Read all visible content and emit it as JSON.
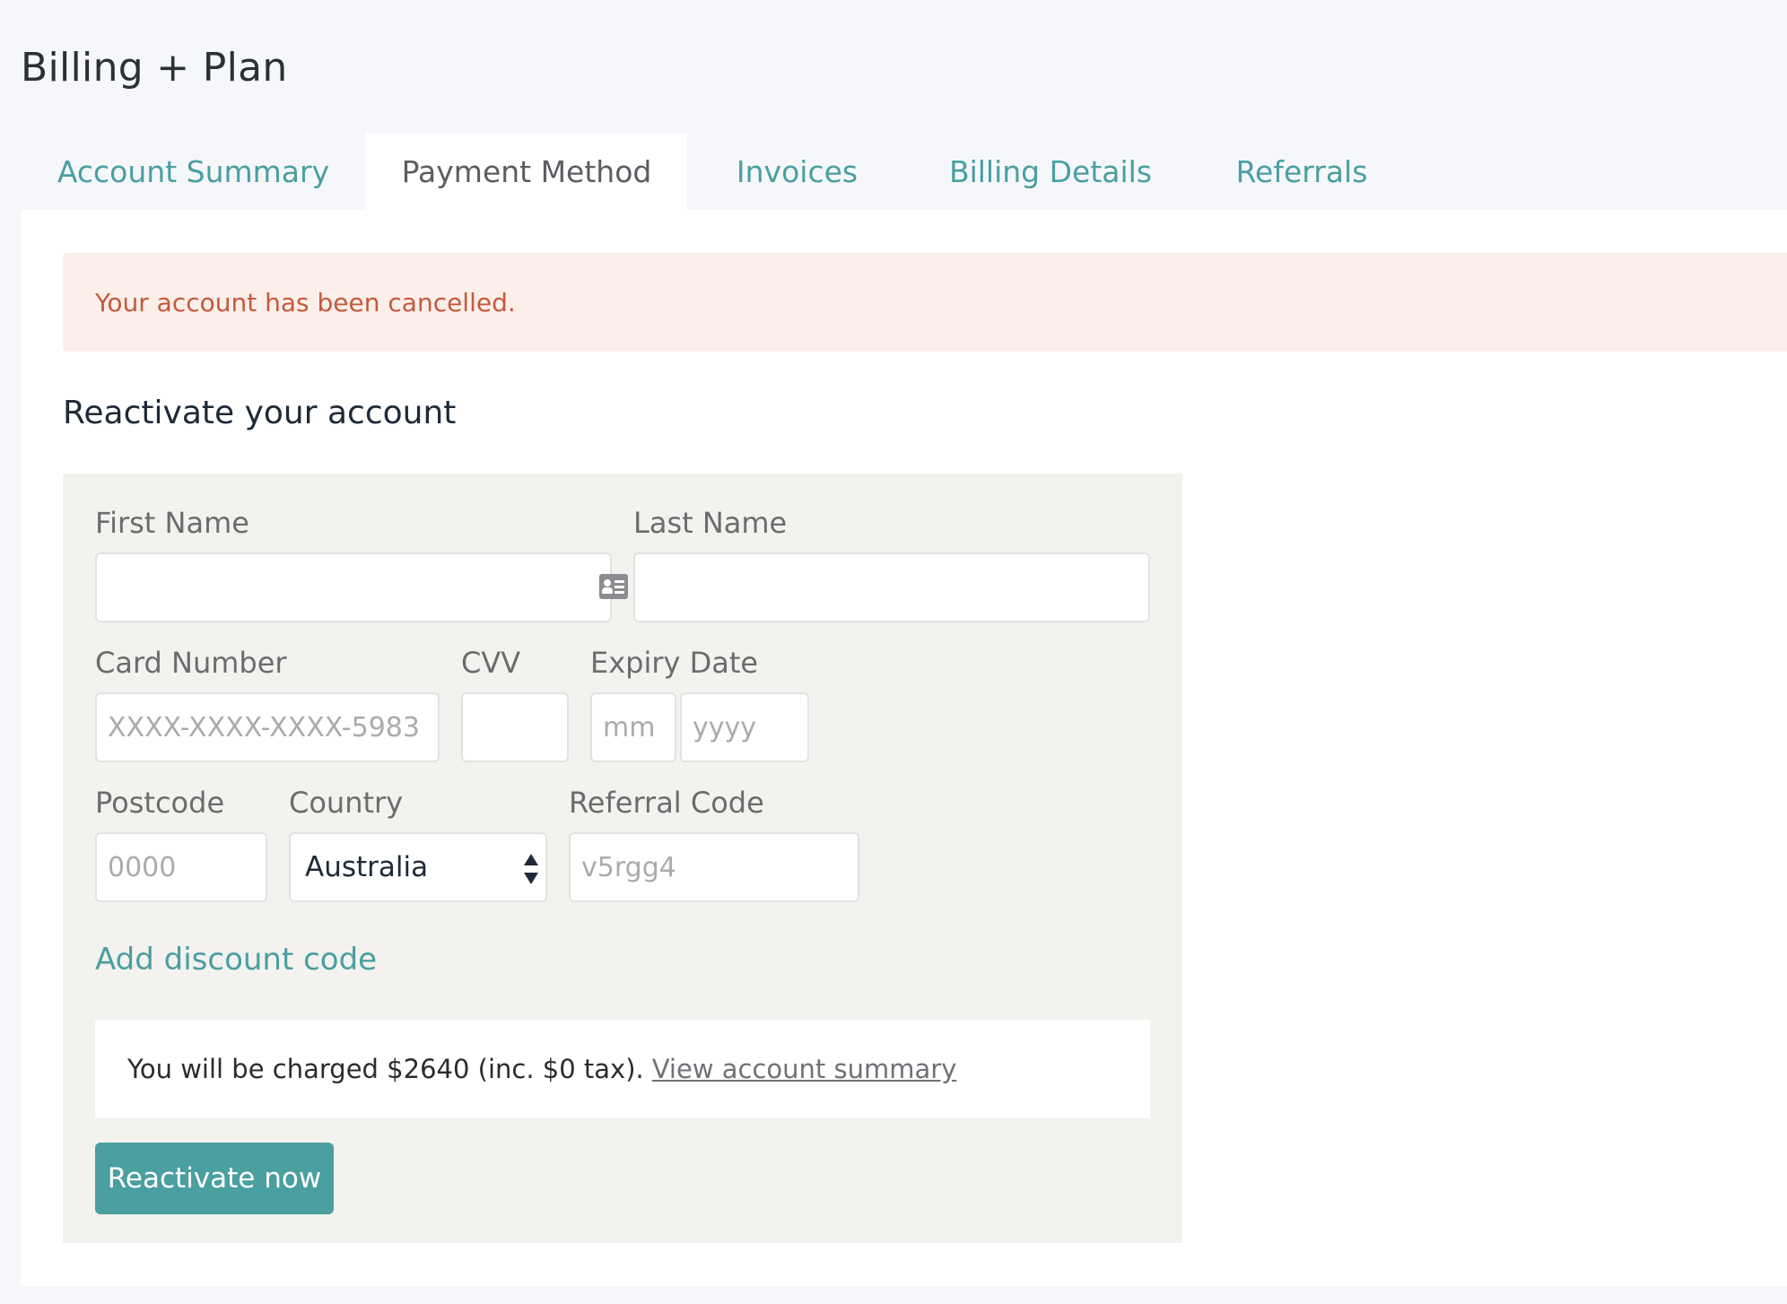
{
  "header": {
    "title": "Billing + Plan"
  },
  "tabs": [
    {
      "label": "Account Summary",
      "active": false
    },
    {
      "label": "Payment Method",
      "active": true
    },
    {
      "label": "Invoices",
      "active": false
    },
    {
      "label": "Billing Details",
      "active": false
    },
    {
      "label": "Referrals",
      "active": false
    }
  ],
  "alert": {
    "message": "Your account has been cancelled."
  },
  "section": {
    "title": "Reactivate your account"
  },
  "form": {
    "first_name": {
      "label": "First Name",
      "value": "",
      "placeholder": ""
    },
    "last_name": {
      "label": "Last Name",
      "value": "",
      "placeholder": ""
    },
    "card_number": {
      "label": "Card Number",
      "value": "",
      "placeholder": "XXXX-XXXX-XXXX-5983"
    },
    "cvv": {
      "label": "CVV",
      "value": "",
      "placeholder": ""
    },
    "expiry": {
      "label": "Expiry Date",
      "month_placeholder": "mm",
      "year_placeholder": "yyyy"
    },
    "postcode": {
      "label": "Postcode",
      "value": "",
      "placeholder": "0000"
    },
    "country": {
      "label": "Country",
      "selected": "Australia"
    },
    "referral_code": {
      "label": "Referral Code",
      "value": "",
      "placeholder": "v5rgg4"
    },
    "discount_link": "Add discount code",
    "charge_text": "You will be charged $2640 (inc. $0 tax).",
    "charge_link": "View account summary",
    "submit_label": "Reactivate now"
  },
  "colors": {
    "accent": "#4a9fa0",
    "alert_bg": "#fcefea",
    "alert_text": "#c45a3c",
    "form_bg": "#f3f2ee",
    "page_bg": "#f6f7fb"
  },
  "icons": {
    "first_name_field": "contact-card-icon",
    "country_select": "select-arrows-icon"
  }
}
